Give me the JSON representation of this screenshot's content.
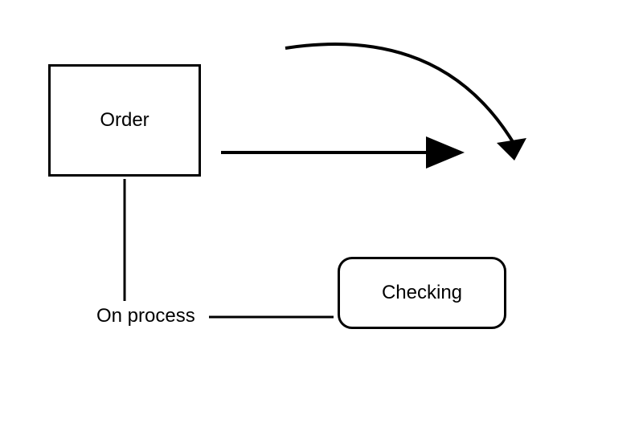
{
  "nodes": {
    "order": {
      "label": "Order"
    },
    "checking": {
      "label": "Checking"
    },
    "on_process": {
      "label": "On process"
    }
  }
}
